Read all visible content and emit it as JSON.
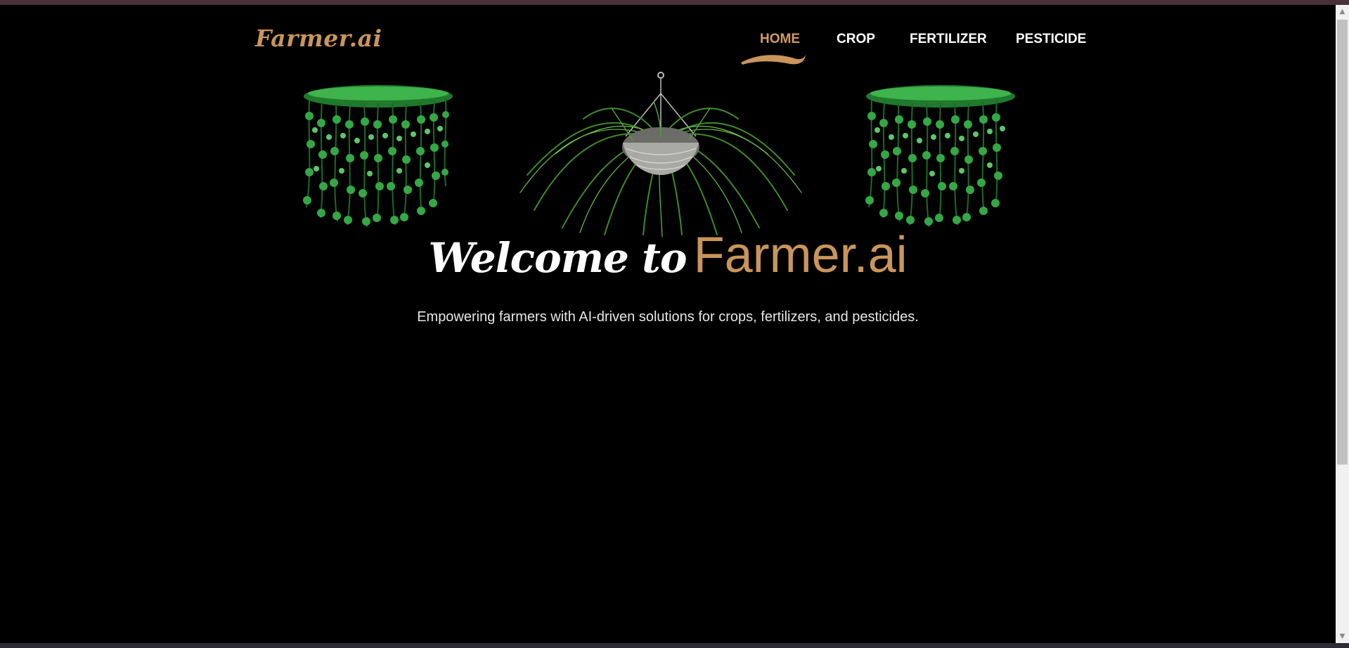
{
  "brand": {
    "logo": "Farmer.ai"
  },
  "nav": {
    "items": [
      {
        "label": "HOME",
        "active": true
      },
      {
        "label": "CROP",
        "active": false
      },
      {
        "label": "FERTILIZER",
        "active": false
      },
      {
        "label": "PESTICIDE",
        "active": false
      }
    ]
  },
  "hero": {
    "welcome": "Welcome to",
    "brand": "Farmer.ai",
    "tagline": "Empowering farmers with AI-driven solutions for crops, fertilizers, and pesticides."
  },
  "colors": {
    "accent": "#c9955a",
    "background": "#000000",
    "leaf_green": "#2e9e3a"
  },
  "icons": {
    "scroll_up": "▲",
    "scroll_down": "▼"
  }
}
